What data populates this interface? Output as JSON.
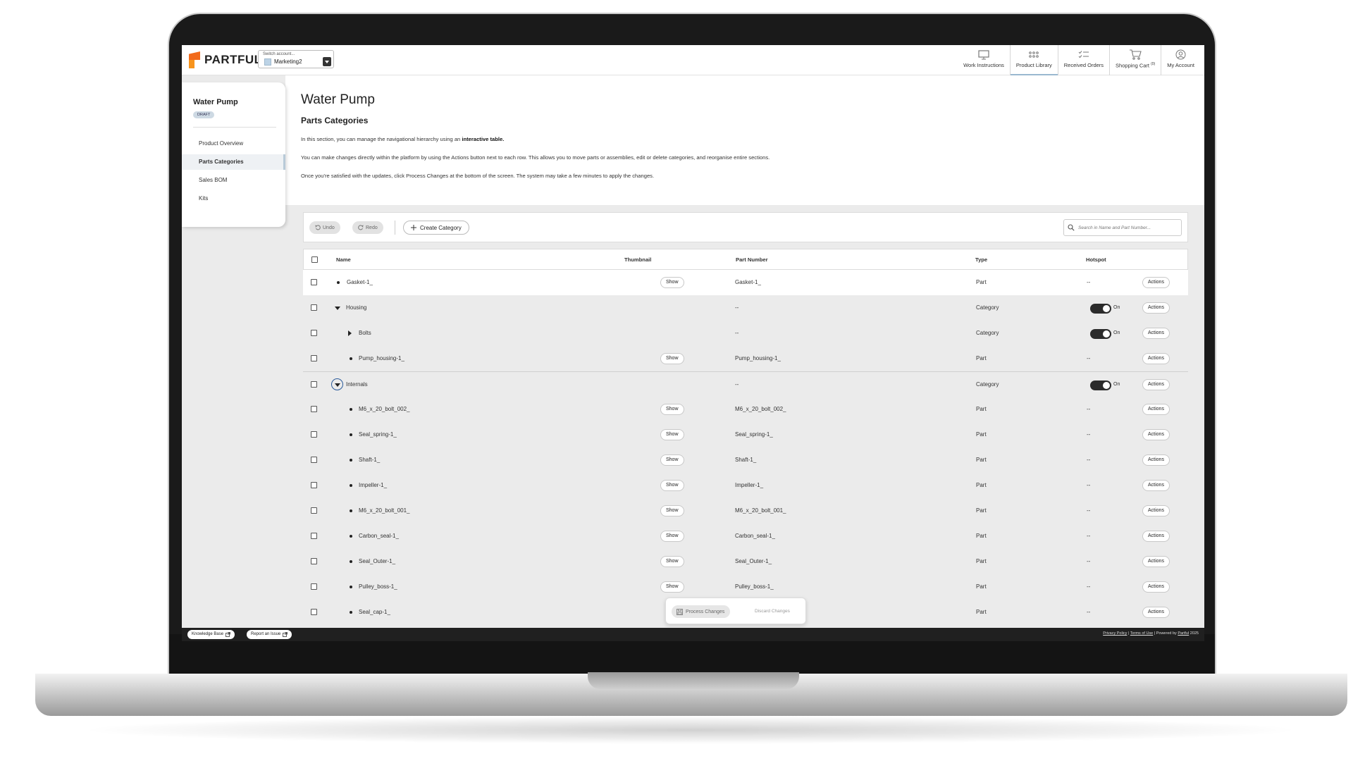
{
  "topbar": {
    "brand": "PARTFUL",
    "account_label": "Switch account...",
    "account_value": "Marketing2",
    "nav": [
      {
        "label": "Work Instructions",
        "icon": "monitor-icon"
      },
      {
        "label": "Product Library",
        "icon": "grid-icon"
      },
      {
        "label": "Received Orders",
        "icon": "checklist-icon"
      },
      {
        "label": "Shopping Cart",
        "icon": "cart-icon",
        "count": "(0)"
      },
      {
        "label": "My Account",
        "icon": "user-icon"
      }
    ]
  },
  "sidebar": {
    "title": "Water Pump",
    "badge": "DRAFT",
    "items": [
      "Product Overview",
      "Parts Categories",
      "Sales BOM",
      "Kits"
    ]
  },
  "header": {
    "title": "Water Pump",
    "subtitle": "Parts Categories",
    "p1_prefix": "In this section, you can manage the navigational hierarchy using an ",
    "p1_bold": "interactive table.",
    "p2": "You can make changes directly within the platform by using the Actions button next to each row. This allows you to move parts or assemblies, edit or delete categories, and reorganise entire sections.",
    "p3": "Once you're satisfied with the updates, click Process Changes at the bottom of the screen. The system may take a few minutes to apply the changes."
  },
  "toolbar": {
    "undo": "Undo",
    "redo": "Redo",
    "create": "Create Category",
    "search_placeholder": "Search in Name and Part Number..."
  },
  "table": {
    "columns": [
      "Name",
      "Thumbnail",
      "Part Number",
      "Type",
      "Hotspot"
    ],
    "show_label": "Show",
    "actions_label": "Actions",
    "toggle_label": "On",
    "rows": [
      {
        "name": "Gasket-1_",
        "thumb": "Show",
        "part": "Gasket-1_",
        "type": "Part",
        "hotspot": "--"
      },
      {
        "name": "Housing",
        "thumb": "",
        "part": "--",
        "type": "Category",
        "hotspot": "On"
      },
      {
        "name": "Bolts",
        "thumb": "",
        "part": "--",
        "type": "Category",
        "hotspot": "On"
      },
      {
        "name": "Pump_housing-1_",
        "thumb": "Show",
        "part": "Pump_housing-1_",
        "type": "Part",
        "hotspot": "--"
      },
      {
        "name": "Internals",
        "thumb": "",
        "part": "--",
        "type": "Category",
        "hotspot": "On"
      },
      {
        "name": "M6_x_20_bolt_002_",
        "thumb": "Show",
        "part": "M6_x_20_bolt_002_",
        "type": "Part",
        "hotspot": "--"
      },
      {
        "name": "Seal_spring-1_",
        "thumb": "Show",
        "part": "Seal_spring-1_",
        "type": "Part",
        "hotspot": "--"
      },
      {
        "name": "Shaft-1_",
        "thumb": "Show",
        "part": "Shaft-1_",
        "type": "Part",
        "hotspot": "--"
      },
      {
        "name": "Impeller-1_",
        "thumb": "Show",
        "part": "Impeller-1_",
        "type": "Part",
        "hotspot": "--"
      },
      {
        "name": "M6_x_20_bolt_001_",
        "thumb": "Show",
        "part": "M6_x_20_bolt_001_",
        "type": "Part",
        "hotspot": "--"
      },
      {
        "name": "Carbon_seal-1_",
        "thumb": "Show",
        "part": "Carbon_seal-1_",
        "type": "Part",
        "hotspot": "--"
      },
      {
        "name": "Seal_Outer-1_",
        "thumb": "Show",
        "part": "Seal_Outer-1_",
        "type": "Part",
        "hotspot": "--"
      },
      {
        "name": "Pulley_boss-1_",
        "thumb": "Show",
        "part": "Pulley_boss-1_",
        "type": "Part",
        "hotspot": "--"
      },
      {
        "name": "Seal_cap-1_",
        "thumb": "",
        "part": "",
        "type": "Part",
        "hotspot": "--"
      }
    ]
  },
  "process": {
    "process_label": "Process Changes",
    "discard_label": "Discard Changes"
  },
  "footer": {
    "knowledge": "Knowledge Base",
    "report": "Report an Issue",
    "privacy": "Privacy Policy",
    "terms": "Terms of Use",
    "powered": "Powered by",
    "brand": "Partful",
    "year": "2025"
  },
  "colors": {
    "brand_orange": "#f26a1b",
    "toggle_on": "#2b2b2b",
    "active_accent": "#9ab8d0"
  }
}
